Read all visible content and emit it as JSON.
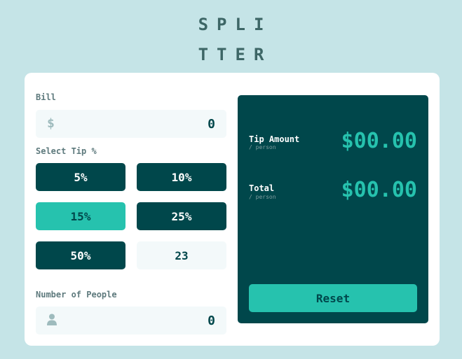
{
  "header": {
    "logo_line1": "SPLI",
    "logo_line2": "TTER"
  },
  "form": {
    "bill_label": "Bill",
    "bill_icon": "$",
    "bill_value": "0",
    "tip_label": "Select Tip %",
    "tips": [
      {
        "label": "5%"
      },
      {
        "label": "10%"
      },
      {
        "label": "15%",
        "active": true
      },
      {
        "label": "25%"
      },
      {
        "label": "50%"
      }
    ],
    "custom_tip_value": "23",
    "people_label": "Number of People",
    "people_value": "0"
  },
  "results": {
    "tip_amount_label": "Tip Amount",
    "tip_amount_sub": "/ person",
    "tip_amount_value": "$00.00",
    "total_label": "Total",
    "total_sub": "/ person",
    "total_value": "$00.00",
    "reset_label": "Reset"
  },
  "colors": {
    "background": "#c5e4e7",
    "dark_teal": "#00474b",
    "accent": "#26c2ae",
    "input_bg": "#f3f9fa"
  },
  "icons": {
    "bill": "dollar-icon",
    "people": "person-icon"
  }
}
